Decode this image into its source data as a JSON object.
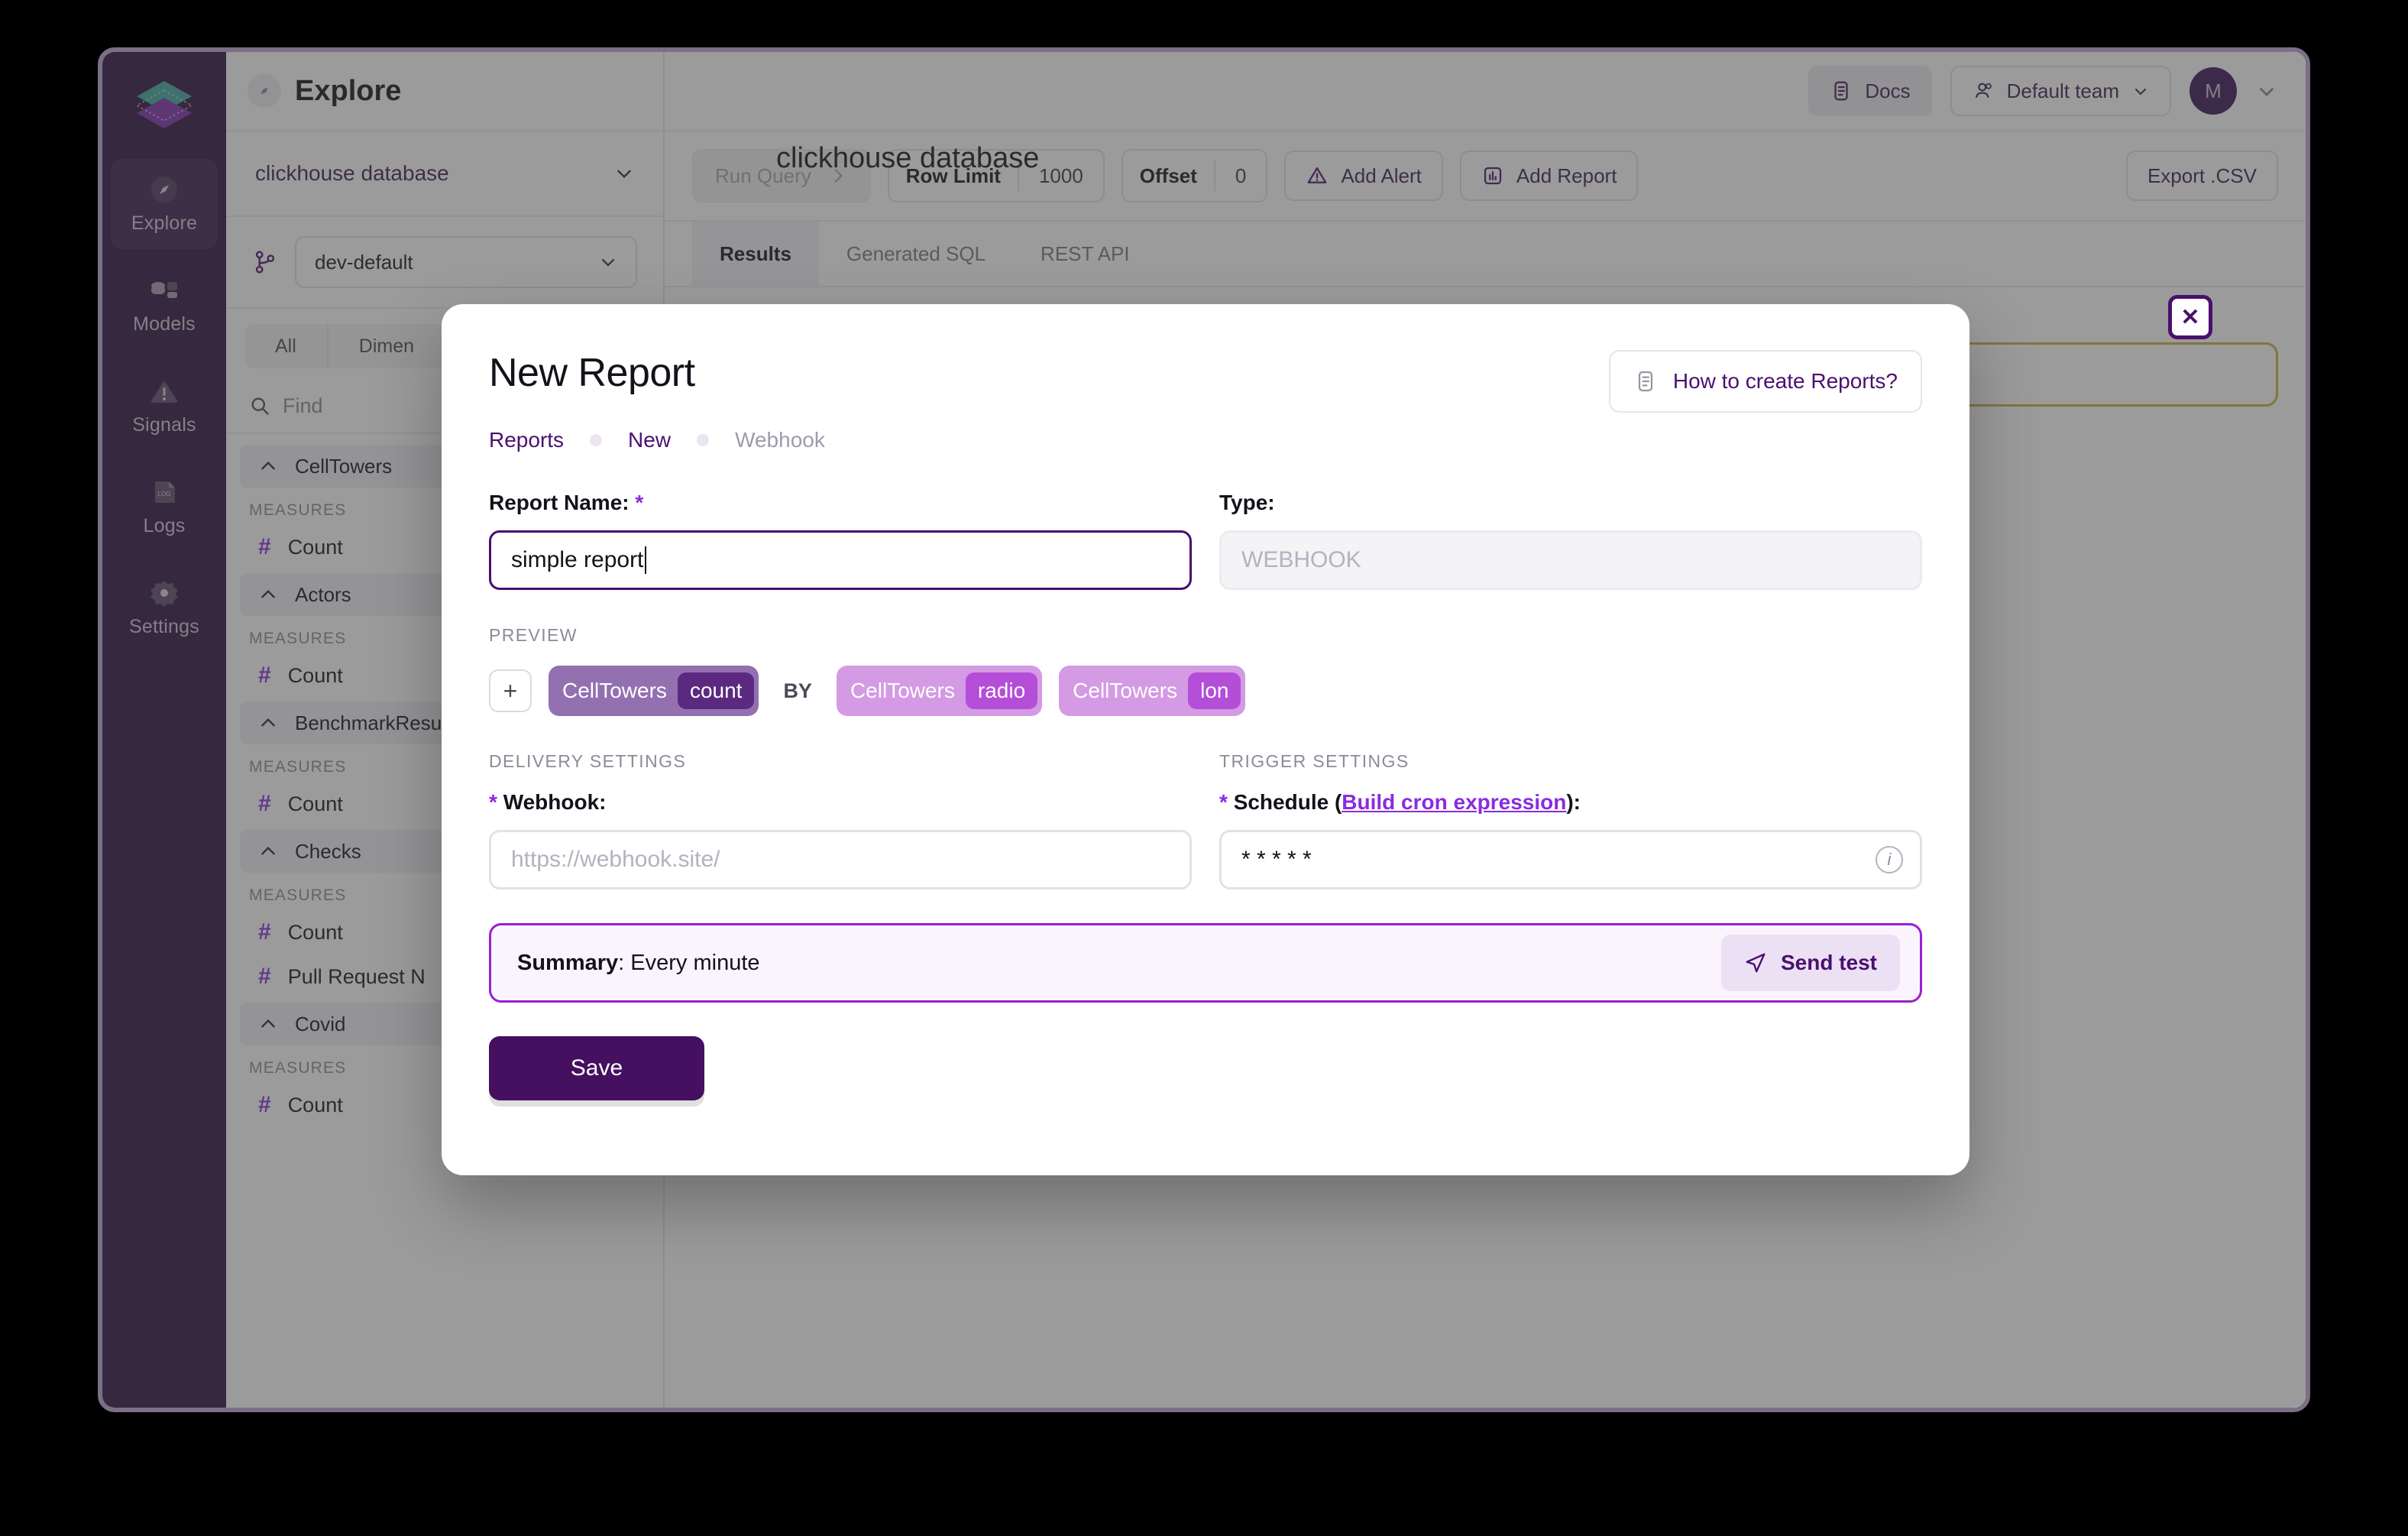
{
  "rail": {
    "logo_icon": "layers-logo-icon",
    "items": [
      {
        "label": "Explore",
        "icon": "compass-icon",
        "active": true
      },
      {
        "label": "Models",
        "icon": "database-icon",
        "active": false
      },
      {
        "label": "Signals",
        "icon": "alert-triangle-icon",
        "active": false
      },
      {
        "label": "Logs",
        "icon": "log-file-icon",
        "active": false
      },
      {
        "label": "Settings",
        "icon": "gear-icon",
        "active": false
      }
    ]
  },
  "panel": {
    "title": "Explore",
    "title_icon": "compass-icon",
    "database": "clickhouse database",
    "database_chevron": "chevron-down-icon",
    "branch_icon": "git-branch-icon",
    "branch": "dev-default",
    "branch_chevron": "chevron-down-icon",
    "tabs": [
      "All",
      "Dimen"
    ],
    "find_icon": "search-icon",
    "find_placeholder": "Find",
    "measures_label": "MEASURES",
    "groups": [
      {
        "name": "CellTowers",
        "measures": [
          "Count"
        ]
      },
      {
        "name": "Actors",
        "measures": [
          "Count"
        ]
      },
      {
        "name": "BenchmarkResult",
        "measures": [
          "Count"
        ]
      },
      {
        "name": "Checks",
        "measures": [
          "Count",
          "Pull Request N"
        ]
      },
      {
        "name": "Covid",
        "measures": [
          "Count"
        ]
      }
    ]
  },
  "header": {
    "title": "clickhouse database",
    "docs_label": "Docs",
    "docs_icon": "doc-icon",
    "team_label": "Default team",
    "team_icon": "users-icon",
    "team_chevron": "chevron-down-icon",
    "avatar_initial": "M",
    "avatar_chevron": "chevron-down-icon"
  },
  "toolbar": {
    "run_query_label": "Run Query",
    "run_query_icon": "chevron-right-icon",
    "row_limit_label": "Row Limit",
    "row_limit_value": "1000",
    "offset_label": "Offset",
    "offset_value": "0",
    "add_alert_label": "Add Alert",
    "add_alert_icon": "alert-triangle-icon",
    "add_report_label": "Add Report",
    "add_report_icon": "bar-chart-icon",
    "export_csv_label": "Export .CSV"
  },
  "tabs": [
    {
      "label": "Results",
      "active": true
    },
    {
      "label": "Generated SQL",
      "active": false
    },
    {
      "label": "REST API",
      "active": false
    }
  ],
  "close_button_icon": "close-icon",
  "modal": {
    "title": "New Report",
    "howto_label": "How to create Reports?",
    "howto_icon": "doc-icon",
    "breadcrumbs": [
      {
        "label": "Reports",
        "muted": false
      },
      {
        "label": "New",
        "muted": false
      },
      {
        "label": "Webhook",
        "muted": true
      }
    ],
    "report_name_label": "Report Name:",
    "report_name_required": "*",
    "report_name_value": "simple report",
    "type_label": "Type:",
    "type_value": "WEBHOOK",
    "preview_label": "PREVIEW",
    "preview_add_icon": "plus-icon",
    "preview_by": "BY",
    "preview_chips": [
      {
        "model": "CellTowers",
        "field": "count",
        "bg": "#9370b0",
        "sub_bg": "#5b2a80"
      },
      {
        "model": "CellTowers",
        "field": "radio",
        "bg": "#d49ae4",
        "sub_bg": "#b44ed8"
      },
      {
        "model": "CellTowers",
        "field": "lon",
        "bg": "#d49ae4",
        "sub_bg": "#b44ed8"
      }
    ],
    "delivery_section_label": "DELIVERY SETTINGS",
    "trigger_section_label": "TRIGGER SETTINGS",
    "webhook_required": "*",
    "webhook_label": "Webhook:",
    "webhook_placeholder": "https://webhook.site/",
    "webhook_value": "",
    "schedule_required": "*",
    "schedule_label_pre": "Schedule (",
    "schedule_link": "Build cron expression",
    "schedule_label_post": "):",
    "schedule_value": "* * * * *",
    "schedule_info_icon": "info-icon",
    "summary_key": "Summary",
    "summary_sep": ": ",
    "summary_value": "Every minute",
    "send_test_label": "Send test",
    "send_test_icon": "send-icon",
    "save_label": "Save"
  },
  "colors": {
    "brand_purple": "#451060",
    "accent_purple": "#8a2be2",
    "rail_bg": "#2d0f40",
    "summary_border": "#9b1fd1",
    "warn_border": "#cbb03a"
  }
}
